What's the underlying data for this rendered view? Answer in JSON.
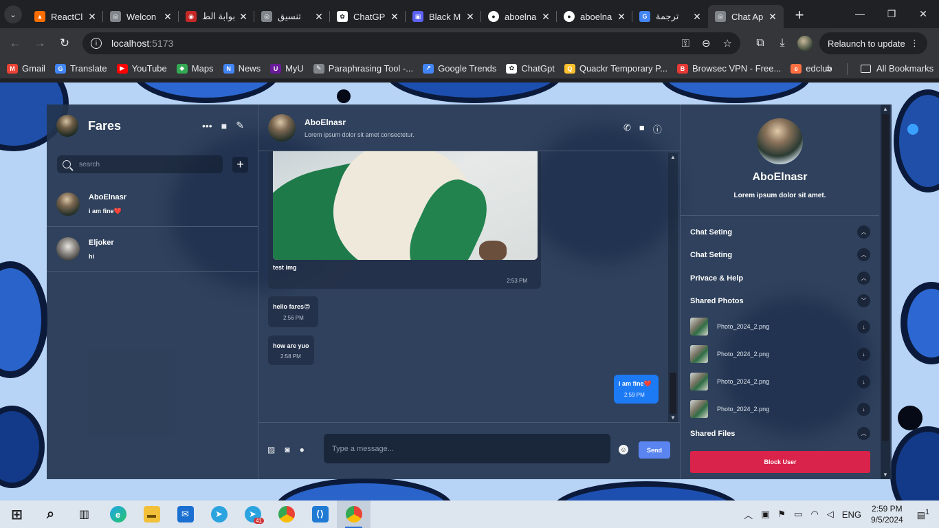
{
  "browser": {
    "tabs": [
      {
        "title": "ReactCl",
        "favicon": "react-flame-icon",
        "color": "#ff6d00"
      },
      {
        "title": "Welcon",
        "favicon": "globe-icon",
        "color": "#80868b"
      },
      {
        "title": "بوابة الط",
        "favicon": "portal-icon",
        "color": "#c62828"
      },
      {
        "title": "تنسيق",
        "favicon": "globe-icon",
        "color": "#80868b"
      },
      {
        "title": "ChatGP",
        "favicon": "openai-icon",
        "color": "#202124"
      },
      {
        "title": "Black M",
        "favicon": "blackbox-icon",
        "color": "#5b61f0"
      },
      {
        "title": "aboelna",
        "favicon": "github-icon",
        "color": "#202124"
      },
      {
        "title": "aboelna",
        "favicon": "github-icon",
        "color": "#202124"
      },
      {
        "title": "ترجمة",
        "favicon": "google-translate-icon",
        "color": "#4285f4"
      },
      {
        "title": "Chat Ap",
        "favicon": "globe-icon",
        "color": "#80868b",
        "active": true
      }
    ],
    "address": {
      "host": "localhost",
      "port": ":5173"
    },
    "relaunch_label": "Relaunch to update",
    "bookmarks": [
      {
        "label": "Gmail",
        "icon": "gmail-icon",
        "color": "#ea4335"
      },
      {
        "label": "Translate",
        "icon": "translate-icon",
        "color": "#4285f4"
      },
      {
        "label": "YouTube",
        "icon": "youtube-icon",
        "color": "#ff0000"
      },
      {
        "label": "Maps",
        "icon": "maps-icon",
        "color": "#34a853"
      },
      {
        "label": "News",
        "icon": "news-icon",
        "color": "#4285f4"
      },
      {
        "label": "MyU",
        "icon": "myu-icon",
        "color": "#6a1b9a"
      },
      {
        "label": "Paraphrasing Tool -...",
        "icon": "quill-icon",
        "color": "#80868b"
      },
      {
        "label": "Google Trends",
        "icon": "trends-icon",
        "color": "#4285f4"
      },
      {
        "label": "ChatGpt",
        "icon": "openai-icon",
        "color": "#202124"
      },
      {
        "label": "Quackr Temporary P...",
        "icon": "quackr-icon",
        "color": "#fbc02d"
      },
      {
        "label": "Browsec VPN - Free...",
        "icon": "browsec-icon",
        "color": "#e53935"
      },
      {
        "label": "edclub",
        "icon": "edclub-icon",
        "color": "#ff7043"
      }
    ],
    "all_bookmarks": "All Bookmarks"
  },
  "app": {
    "sidebar": {
      "user_name": "Fares",
      "search_placeholder": "search",
      "chats": [
        {
          "name": "AboElnasr",
          "last": "i am fine❤️"
        },
        {
          "name": "Eljoker",
          "last": "hi"
        }
      ]
    },
    "chat": {
      "name": "AboElnasr",
      "status": "Lorem ipsum dolor sit amet consectetur.",
      "messages": [
        {
          "text": "test img",
          "time": "2:53 PM",
          "from": "other",
          "image": true
        },
        {
          "text": "hello fares😍",
          "time": "2:56 PM",
          "from": "other"
        },
        {
          "text": "how are yuo",
          "time": "2:58 PM",
          "from": "other"
        },
        {
          "text": "i am fine❤️",
          "time": "2:59 PM",
          "from": "me"
        }
      ],
      "input_placeholder": "Type a message...",
      "send_label": "Send"
    },
    "details": {
      "name": "AboElnasr",
      "bio": "Lorem ipsum dolor sit amet.",
      "sections": [
        "Chat Seting",
        "Chat Seting",
        "Privace & Help",
        "Shared Photos"
      ],
      "photos": [
        "Photo_2024_2.png",
        "Photo_2024_2.png",
        "Photo_2024_2.png",
        "Photo_2024_2.png"
      ],
      "shared_files": "Shared Files",
      "block_label": "Block User"
    }
  },
  "taskbar": {
    "language": "ENG",
    "time": "2:59 PM",
    "date": "9/5/2024",
    "telegram_badge": "41",
    "notification_count": "1"
  }
}
